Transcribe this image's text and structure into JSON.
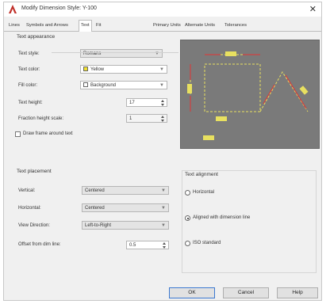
{
  "window": {
    "title": "Modify Dimension Style: Y-100",
    "close_glyph": "✕"
  },
  "tabs": [
    {
      "label": "Lines"
    },
    {
      "label": "Symbols and Arrows"
    },
    {
      "label": "Text"
    },
    {
      "label": "Fit"
    },
    {
      "label": "Primary Units"
    },
    {
      "label": "Alternate Units"
    },
    {
      "label": "Tolerances"
    }
  ],
  "active_tab": "Text",
  "appearance": {
    "title": "Text appearance",
    "text_style_label": "Text style:",
    "text_style_value": "Romans",
    "text_color_label": "Text color:",
    "text_color_value": "Yellow",
    "text_color_hex": "#f0e030",
    "fill_color_label": "Fill color:",
    "fill_color_value": "Background",
    "text_height_label": "Text height:",
    "text_height_value": "17",
    "fraction_label": "Fraction height scale:",
    "fraction_value": "1",
    "frame_label": "Draw frame around text",
    "frame_checked": false
  },
  "placement": {
    "title": "Text placement",
    "vertical_label": "Vertical:",
    "vertical_value": "Centered",
    "horizontal_label": "Horizontal:",
    "horizontal_value": "Centered",
    "view_dir_label": "View Direction:",
    "view_dir_value": "Left-to-Right",
    "offset_label": "Offset from dim line:",
    "offset_value": "0.5"
  },
  "alignment": {
    "title": "Text alignment",
    "options": [
      {
        "label": "Horizontal",
        "selected": false
      },
      {
        "label": "Aligned with dimension line",
        "selected": true
      },
      {
        "label": "ISO standard",
        "selected": false
      }
    ]
  },
  "buttons": {
    "ok": "OK",
    "cancel": "Cancel",
    "help": "Help"
  },
  "colors": {
    "preview_bg": "#7a7a7a",
    "preview_dim": "#e8e060",
    "preview_arrow": "#d04040",
    "accent": "#3b78d0",
    "app_icon": "#c0302a"
  }
}
